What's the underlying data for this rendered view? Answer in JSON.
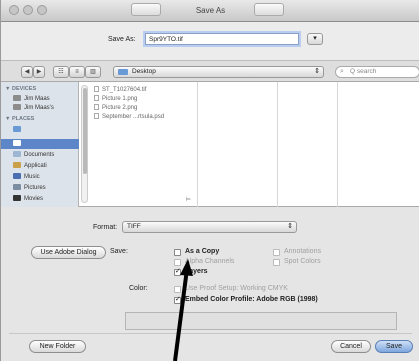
{
  "window": {
    "title": "Save As"
  },
  "save_as": {
    "label": "Save As:",
    "value": "Spr9YTO.tif"
  },
  "nav": {
    "back": "◀",
    "forward": "▶",
    "view_buttons": [
      "☷",
      "≡",
      "▥"
    ],
    "location": "Desktop",
    "search_placeholder": "Q search"
  },
  "sidebar": {
    "devices_header": "▼ DEVICES",
    "devices": [
      "Jim Maas",
      "Jim Maas's"
    ],
    "places_header": "▼ PLACES",
    "places": [
      "",
      "Documents",
      "Applicati",
      "Music",
      "Pictures",
      "Movies"
    ]
  },
  "files": [
    "ST_T1027604.tif",
    "Picture 1.png",
    "Picture 2.png",
    "September ...rtsula.psd"
  ],
  "format": {
    "label": "Format:",
    "value": "TIFF"
  },
  "use_adobe_dialog": "Use Adobe Dialog",
  "save_options": {
    "label": "Save:",
    "as_a_copy": "As a Copy",
    "alpha_channels": "Alpha Channels",
    "layers": "Layers",
    "annotations": "Annotations",
    "spot_colors": "Spot Colors"
  },
  "color": {
    "label": "Color:",
    "use_proof_setup": "Use Proof Setup:  Working CMYK",
    "embed_profile": "Embed Color Profile:  Adobe RGB (1998)"
  },
  "buttons": {
    "new_folder": "New Folder",
    "cancel": "Cancel",
    "save": "Save"
  },
  "colors": {
    "accent": "#5d86c8",
    "default_button": "#7ea6dd",
    "annotation_arrow": "#000000"
  }
}
